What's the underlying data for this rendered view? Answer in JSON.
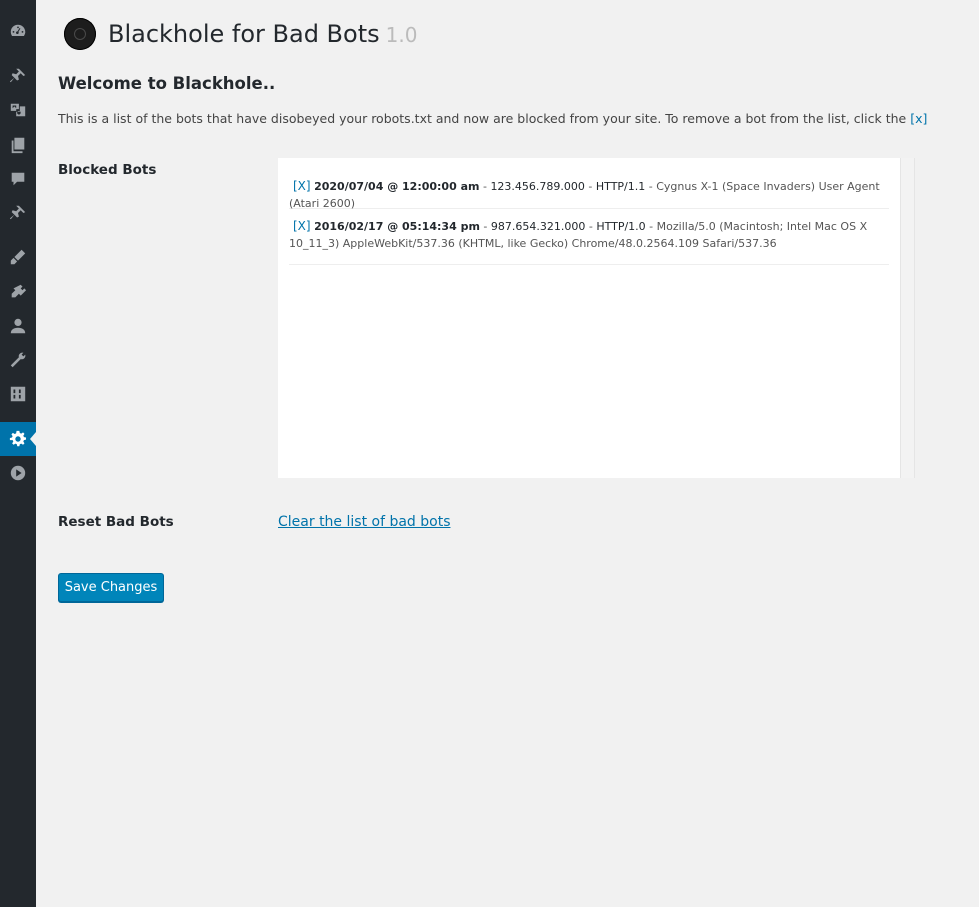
{
  "sidebar": {
    "icons": [
      "dashboard-icon",
      "pin-icon",
      "media-icon",
      "pages-icon",
      "comments-icon",
      "pin-icon",
      "appearance-icon",
      "plugins-icon",
      "users-icon",
      "tools-icon",
      "settings-icon",
      "gear-icon",
      "play-icon"
    ]
  },
  "header": {
    "title": "Blackhole for Bad Bots",
    "version": "1.0"
  },
  "welcome": "Welcome to Blackhole..",
  "intro": {
    "text": "This is a list of the bots that have disobeyed your robots.txt and now are blocked from your site. To remove a bot from the list, click the",
    "x": "[x]"
  },
  "blocked": {
    "label": "Blocked Bots",
    "bots": [
      {
        "del": "[X]",
        "date": "2020/07/04 @ 12:00:00 am",
        "ip": "123.456.789.000",
        "proto": "HTTP/1.1",
        "ua": "Cygnus X-1 (Space Invaders) User Agent (Atari 2600)"
      },
      {
        "del": "[X]",
        "date": "2016/02/17 @ 05:14:34 pm",
        "ip": "987.654.321.000",
        "proto": "HTTP/1.0",
        "ua": "Mozilla/5.0 (Macintosh; Intel Mac OS X 10_11_3) AppleWebKit/537.36 (KHTML, like Gecko) Chrome/48.0.2564.109 Safari/537.36"
      }
    ]
  },
  "reset": {
    "label": "Reset Bad Bots",
    "link": "Clear the list of bad bots"
  },
  "save_label": "Save Changes",
  "colors": {
    "sidebar_bg": "#23282d",
    "accent": "#0073aa",
    "button": "#0085ba",
    "page_bg": "#f1f1f1"
  }
}
